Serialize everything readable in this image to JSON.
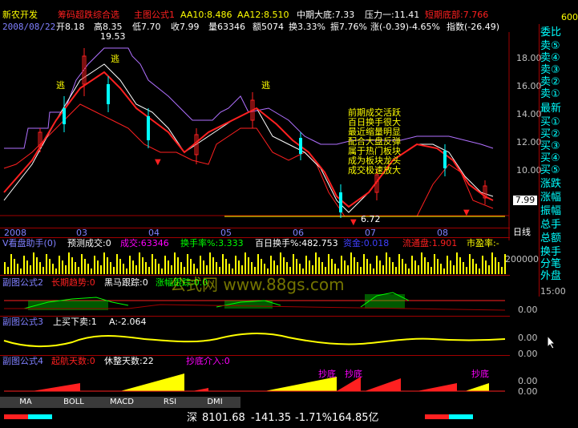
{
  "app": {
    "stock_name": "新农开发",
    "formula_title": "筹码超跌综合选",
    "main_formula": "主图公式1",
    "aa10": "AA10:8.486",
    "aa12": "AA12:8.510",
    "mid_support": "中期大底:7.33",
    "pressure": "压力一:11.41",
    "short_bottom": "短期底部:7.766",
    "scale_label": "600",
    "colors": {
      "red": "#ff2020",
      "yellow": "#ffff00",
      "cyan": "#00ffff",
      "green": "#00ff00",
      "white": "#ffffff",
      "magenta": "#ff00ff",
      "purple": "#b070ff",
      "orange": "#ff8000"
    }
  },
  "quote": {
    "date": "2008/08/22",
    "open": "开8.18",
    "high": "高8.35",
    "low": "低7.70",
    "close": "收7.99",
    "volume": "量63346",
    "amount": "额5074",
    "turnover": "换3.33%",
    "amplitude": "振7.76%",
    "change": "涨(-0.39)-4.65%",
    "index": "指数(-26.49)"
  },
  "main_chart": {
    "y_ticks": [
      "18.00",
      "16.00",
      "14.00",
      "12.00",
      "10.00"
    ],
    "peak_label": "19.53",
    "low_label": "6.72",
    "escape_labels": [
      "逃",
      "逃",
      "逃"
    ],
    "current_price": "7.99",
    "annotation_lines": [
      "前期成交活跃",
      "百日换手很大",
      "最近缩量明显",
      "配合大盘反弹",
      "属于热门板块",
      "成为板块龙头",
      "成交极速放大"
    ],
    "x_labels": [
      "2008",
      "03",
      "04",
      "05",
      "06",
      "07",
      "08"
    ],
    "cycle_label": "日线"
  },
  "sub1": {
    "title": "V看盘助手(0)",
    "predicted_vol": "预测成交:0",
    "vol": "成交:63346",
    "turnover_rate": "换手率%:3.333",
    "hundred_turnover": "百日换手%:482.753",
    "inflow": "资金:0.018",
    "float_cap": "流通盘:1.901",
    "pe": "市盈率:-",
    "y_tick": "200000"
  },
  "sub2": {
    "title": "副图公式2",
    "trend": "长期趋势:0",
    "black_horse": "黑马跟踪:0",
    "rise_track": "涨幅跟踪:0.0",
    "y_tick": "0.00"
  },
  "sub3": {
    "title": "副图公式3",
    "updown": "上买下卖:1",
    "a_value": "A:-2.064",
    "y_ticks": [
      "0.00",
      "0.00"
    ]
  },
  "sub4": {
    "title": "副图公式4",
    "takeoff": "起航天数:0",
    "rest": "休整天数:22",
    "bottom_buy": "抄底介入:0",
    "labels": [
      "抄底",
      "抄底",
      "抄底"
    ],
    "y_ticks": [
      "0.00",
      "0.00"
    ]
  },
  "sidebar": {
    "top_label": "委比",
    "sell_items": [
      "卖⑤",
      "卖④",
      "卖③",
      "卖②",
      "卖①"
    ],
    "latest": "最新",
    "buy_items": [
      "买①",
      "买②",
      "买③",
      "买④",
      "买⑤"
    ],
    "stats": [
      "涨跌",
      "涨幅",
      "振幅",
      "总手",
      "总额",
      "换手",
      "分笔",
      "外盘"
    ],
    "time": "15:00",
    "value_right": "7.99"
  },
  "tabs": [
    "MA",
    "BOLL",
    "MACD",
    "RSI",
    "DMI"
  ],
  "status": {
    "market": "深",
    "index_value": "8101.68",
    "index_change": "-141.35",
    "index_pct": "-1.71%",
    "index_amount": "164.85亿"
  },
  "watermark": "公式网 www.88gs.com"
}
